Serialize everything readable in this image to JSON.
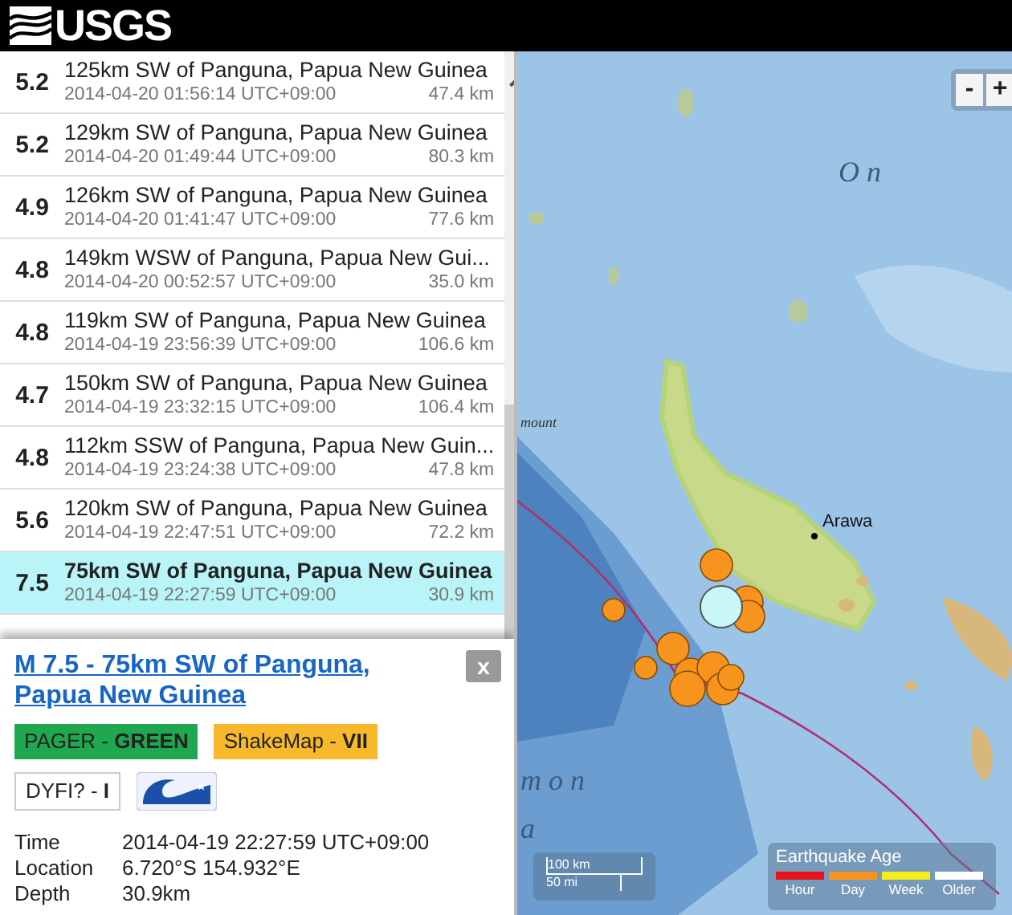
{
  "header": {
    "logo_text": "USGS"
  },
  "earthquakes": [
    {
      "magnitude": "5.2",
      "title": "125km SW of Panguna, Papua New Guinea",
      "time": "2014-04-20 01:56:14 UTC+09:00",
      "depth": "47.4 km",
      "selected": false
    },
    {
      "magnitude": "5.2",
      "title": "129km SW of Panguna, Papua New Guinea",
      "time": "2014-04-20 01:49:44 UTC+09:00",
      "depth": "80.3 km",
      "selected": false
    },
    {
      "magnitude": "4.9",
      "title": "126km SW of Panguna, Papua New Guinea",
      "time": "2014-04-20 01:41:47 UTC+09:00",
      "depth": "77.6 km",
      "selected": false
    },
    {
      "magnitude": "4.8",
      "title": "149km WSW of Panguna, Papua New Gui...",
      "time": "2014-04-20 00:52:57 UTC+09:00",
      "depth": "35.0 km",
      "selected": false
    },
    {
      "magnitude": "4.8",
      "title": "119km SW of Panguna, Papua New Guinea",
      "time": "2014-04-19 23:56:39 UTC+09:00",
      "depth": "106.6 km",
      "selected": false
    },
    {
      "magnitude": "4.7",
      "title": "150km SW of Panguna, Papua New Guinea",
      "time": "2014-04-19 23:32:15 UTC+09:00",
      "depth": "106.4 km",
      "selected": false
    },
    {
      "magnitude": "4.8",
      "title": "112km SSW of Panguna, Papua New Guin...",
      "time": "2014-04-19 23:24:38 UTC+09:00",
      "depth": "47.8 km",
      "selected": false
    },
    {
      "magnitude": "5.6",
      "title": "120km SW of Panguna, Papua New Guinea",
      "time": "2014-04-19 22:47:51 UTC+09:00",
      "depth": "72.2 km",
      "selected": false
    },
    {
      "magnitude": "7.5",
      "title": "75km SW of Panguna, Papua New Guinea",
      "time": "2014-04-19 22:27:59 UTC+09:00",
      "depth": "30.9 km",
      "selected": true
    }
  ],
  "popup": {
    "title": "M 7.5 - 75km SW of Panguna, Papua New Guinea",
    "close": "x",
    "badges": [
      {
        "kind": "pager",
        "text": "PAGER - **GREEN**",
        "color": "#1fa84f"
      },
      {
        "kind": "shakemap",
        "text": "ShakeMap - **VII**",
        "color": "#f7b92b"
      },
      {
        "kind": "dyfi",
        "text": "DYFI? - **I**",
        "color": "#ffffff"
      },
      {
        "kind": "tsunami"
      }
    ],
    "details": [
      {
        "label": "Time",
        "value": "2014-04-19 22:27:59 UTC+09:00"
      },
      {
        "label": "Location",
        "value": "6.720°S 154.932°E"
      },
      {
        "label": "Depth",
        "value": "30.9km"
      }
    ]
  },
  "map": {
    "zoom_controls": [
      "-",
      "+"
    ],
    "labels": [
      "O n",
      "mount",
      "Arawa",
      "m o n",
      "a"
    ],
    "scale": [
      "100 km",
      "50 mi"
    ],
    "legend": {
      "title": "Earthquake Age",
      "items": [
        {
          "label": "Hour",
          "color": "#e8141a"
        },
        {
          "label": "Day",
          "color": "#f7941d"
        },
        {
          "label": "Week",
          "color": "#f5ee1b"
        },
        {
          "label": "Older",
          "color": "#ffffff"
        }
      ]
    }
  }
}
